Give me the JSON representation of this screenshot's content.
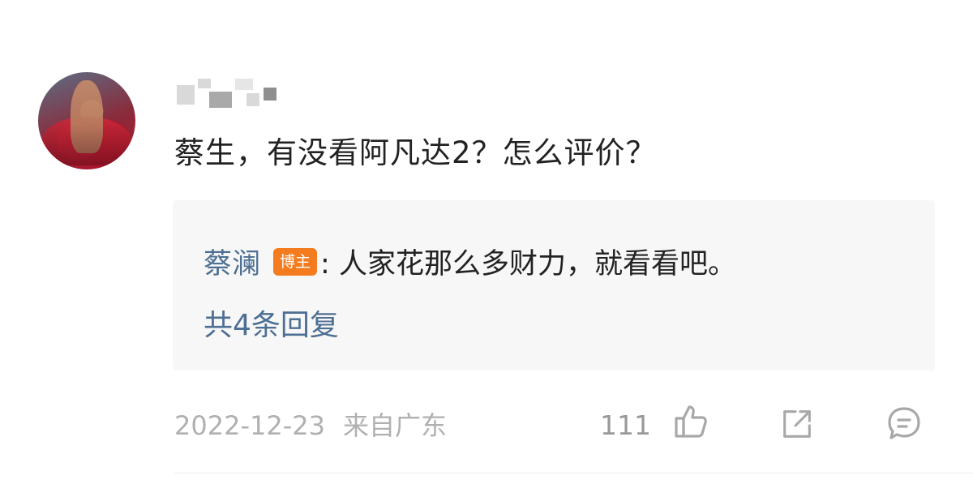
{
  "comment": {
    "text": "蔡生，有没看阿凡达2？怎么评价？"
  },
  "reply": {
    "author": "蔡澜",
    "badge": "博主",
    "text": ": 人家花那么多财力，就看看吧。",
    "count_label": "共4条回复"
  },
  "meta": {
    "date": "2022-12-23",
    "location": "来自广东",
    "likes": "111"
  },
  "icons": {
    "like": "thumbs-up-icon",
    "share": "share-icon",
    "comment": "comment-icon"
  },
  "colors": {
    "link_blue": "#4d6f93",
    "badge_orange": "#f47c1f",
    "muted_gray": "#b0b0b0"
  }
}
